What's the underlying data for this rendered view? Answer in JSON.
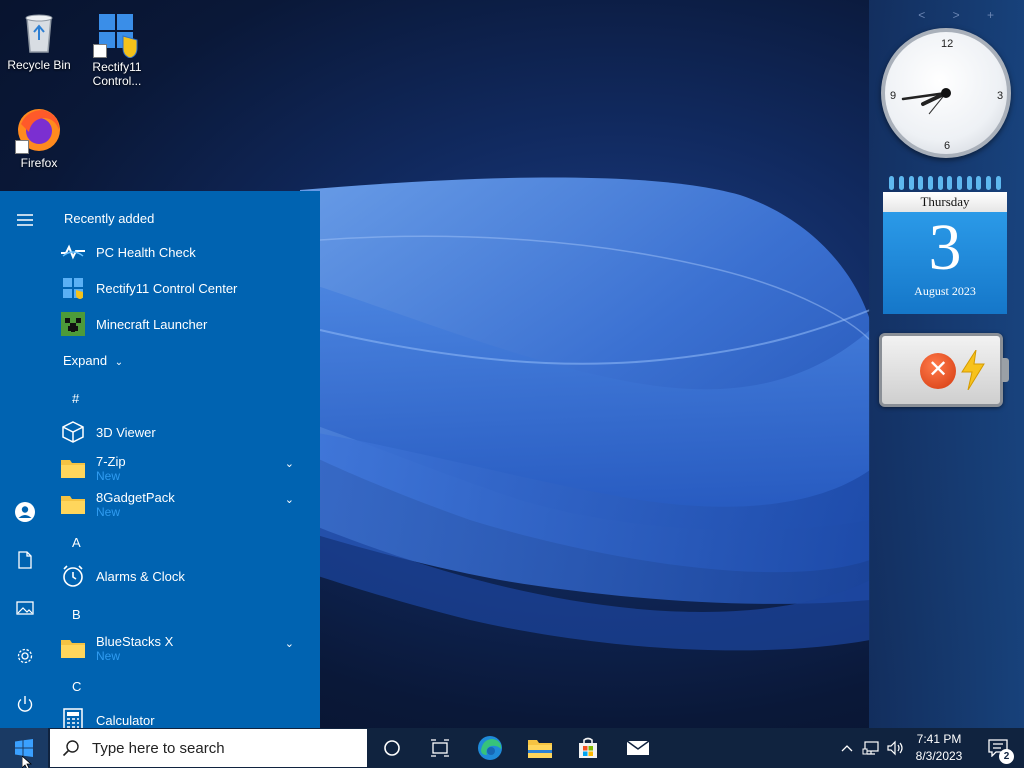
{
  "desktop": {
    "icons": [
      {
        "label": "Recycle Bin"
      },
      {
        "label": "Rectify11 Control..."
      },
      {
        "label": "Firefox"
      }
    ]
  },
  "gadgets": {
    "nav": "< > +",
    "clock": {
      "n12": "12",
      "n3": "3",
      "n6": "6",
      "n9": "9",
      "time": "7:41"
    },
    "calendar": {
      "weekday": "Thursday",
      "day": "3",
      "month_year": "August 2023"
    },
    "battery": {
      "status_icon": "x-icon",
      "charging_icon": "lightning-icon"
    }
  },
  "start_menu": {
    "recently_added_title": "Recently added",
    "recent": [
      {
        "name": "PC Health Check",
        "icon": "health-check-icon"
      },
      {
        "name": "Rectify11 Control Center",
        "icon": "windows-logo-icon"
      },
      {
        "name": "Minecraft Launcher",
        "icon": "minecraft-icon"
      }
    ],
    "expand_label": "Expand",
    "letters": {
      "hash": "#",
      "a": "A",
      "b": "B",
      "c": "C"
    },
    "apps": {
      "viewer": {
        "name": "3D Viewer"
      },
      "zip": {
        "name": "7-Zip",
        "sub": "New"
      },
      "gadget": {
        "name": "8GadgetPack",
        "sub": "New"
      },
      "alarms": {
        "name": "Alarms & Clock"
      },
      "bluestacks": {
        "name": "BlueStacks X",
        "sub": "New"
      },
      "calculator": {
        "name": "Calculator"
      }
    }
  },
  "taskbar": {
    "search_placeholder": "Type here to search",
    "time": "7:41 PM",
    "date": "8/3/2023",
    "notification_count": "2"
  },
  "colors": {
    "start_bg": "#0063b1",
    "taskbar_bg": "#10233f",
    "accent": "#2f9bf0"
  }
}
